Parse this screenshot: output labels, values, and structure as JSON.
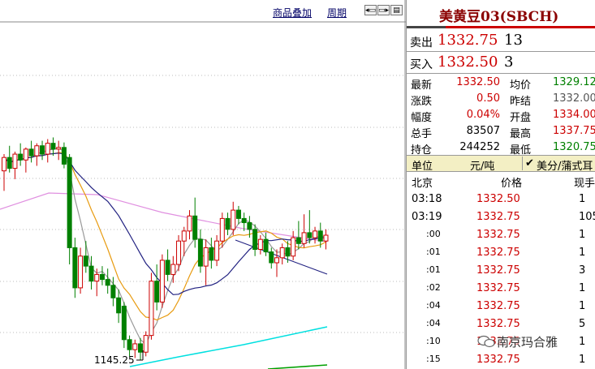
{
  "toolbar": {
    "overlay_label": "商品叠加",
    "period_label": "周期"
  },
  "chart": {
    "low_label": "1145.25"
  },
  "quote": {
    "title": "美黄豆03(SBCH)",
    "sell_label": "卖出",
    "sell_price": "1332.75",
    "sell_volume": "13",
    "buy_label": "买入",
    "buy_price": "1332.50",
    "buy_volume": "3",
    "rows": [
      {
        "l1": "最新",
        "v1": "1332.50",
        "c1": "#cc0000",
        "l2": "均价",
        "v2": "1329.12",
        "c2": "#008000"
      },
      {
        "l1": "涨跌",
        "v1": "0.50",
        "c1": "#cc0000",
        "l2": "昨结",
        "v2": "1332.00",
        "c2": "#555555"
      },
      {
        "l1": "幅度",
        "v1": "0.04%",
        "c1": "#cc0000",
        "l2": "开盘",
        "v2": "1334.00",
        "c2": "#cc0000"
      },
      {
        "l1": "总手",
        "v1": "83507",
        "c1": "#000000",
        "l2": "最高",
        "v2": "1337.75",
        "c2": "#cc0000"
      },
      {
        "l1": "持仓",
        "v1": "244252",
        "c1": "#000000",
        "l2": "最低",
        "v2": "1320.75",
        "c2": "#008000"
      }
    ]
  },
  "units": {
    "label": "单位",
    "value": "元/吨",
    "unit2": "美分/蒲式耳"
  },
  "ticks": {
    "head_time": "北京",
    "head_price": "价格",
    "head_vol": "现手",
    "rows": [
      {
        "time": "03:18",
        "sub": false,
        "price": "1332.50",
        "vol": "1"
      },
      {
        "time": "03:19",
        "sub": false,
        "price": "1332.75",
        "vol": "105"
      },
      {
        "time": ":00",
        "sub": true,
        "price": "1332.75",
        "vol": "1"
      },
      {
        "time": ":01",
        "sub": true,
        "price": "1332.75",
        "vol": "1"
      },
      {
        "time": ":01",
        "sub": true,
        "price": "1332.75",
        "vol": "3"
      },
      {
        "time": ":02",
        "sub": true,
        "price": "1332.75",
        "vol": "1"
      },
      {
        "time": ":04",
        "sub": true,
        "price": "1332.75",
        "vol": "1"
      },
      {
        "time": ":04",
        "sub": true,
        "price": "1332.75",
        "vol": "5"
      },
      {
        "time": ":10",
        "sub": true,
        "price": "1332.75",
        "vol": "1"
      },
      {
        "time": ":15",
        "sub": true,
        "price": "1332.75",
        "vol": "1"
      }
    ]
  },
  "watermark": {
    "text": "南京玛合雅"
  },
  "colors": {
    "up": "#cc0000",
    "down": "#008000",
    "ma_orange": "#e89b10",
    "ma_navy": "#202080",
    "ma_pink": "#e090e0",
    "ma_cyan": "#00e0e0"
  },
  "candles": [
    {
      "o": 1242,
      "h": 1262,
      "l": 1218,
      "c": 1258
    },
    {
      "o": 1258,
      "h": 1272,
      "l": 1240,
      "c": 1245
    },
    {
      "o": 1245,
      "h": 1265,
      "l": 1232,
      "c": 1262
    },
    {
      "o": 1262,
      "h": 1275,
      "l": 1248,
      "c": 1255
    },
    {
      "o": 1255,
      "h": 1270,
      "l": 1240,
      "c": 1268
    },
    {
      "o": 1268,
      "h": 1278,
      "l": 1252,
      "c": 1260
    },
    {
      "o": 1260,
      "h": 1275,
      "l": 1248,
      "c": 1272
    },
    {
      "o": 1272,
      "h": 1278,
      "l": 1255,
      "c": 1262
    },
    {
      "o": 1262,
      "h": 1280,
      "l": 1252,
      "c": 1275
    },
    {
      "o": 1275,
      "h": 1282,
      "l": 1260,
      "c": 1268
    },
    {
      "o": 1268,
      "h": 1278,
      "l": 1255,
      "c": 1270
    },
    {
      "o": 1270,
      "h": 1276,
      "l": 1245,
      "c": 1250
    },
    {
      "o": 1258,
      "h": 1262,
      "l": 1130,
      "c": 1150
    },
    {
      "o": 1150,
      "h": 1162,
      "l": 1090,
      "c": 1102
    },
    {
      "o": 1102,
      "h": 1150,
      "l": 1095,
      "c": 1140
    },
    {
      "o": 1140,
      "h": 1158,
      "l": 1120,
      "c": 1128
    },
    {
      "o": 1128,
      "h": 1140,
      "l": 1100,
      "c": 1110
    },
    {
      "o": 1110,
      "h": 1125,
      "l": 1092,
      "c": 1118
    },
    {
      "o": 1118,
      "h": 1128,
      "l": 1105,
      "c": 1112
    },
    {
      "o": 1112,
      "h": 1125,
      "l": 1095,
      "c": 1105
    },
    {
      "o": 1105,
      "h": 1115,
      "l": 1080,
      "c": 1090
    },
    {
      "o": 1090,
      "h": 1100,
      "l": 1060,
      "c": 1072
    },
    {
      "o": 1080,
      "h": 1085,
      "l": 1030,
      "c": 1040
    },
    {
      "o": 1040,
      "h": 1045,
      "l": 1020,
      "c": 1028
    },
    {
      "o": 1028,
      "h": 1040,
      "l": 1018,
      "c": 1035
    },
    {
      "o": 1035,
      "h": 1042,
      "l": 1015,
      "c": 1025
    },
    {
      "o": 1025,
      "h": 1050,
      "l": 1020,
      "c": 1045
    },
    {
      "o": 1045,
      "h": 1120,
      "l": 1040,
      "c": 1110
    },
    {
      "o": 1110,
      "h": 1130,
      "l": 1075,
      "c": 1085
    },
    {
      "o": 1085,
      "h": 1142,
      "l": 1078,
      "c": 1135
    },
    {
      "o": 1135,
      "h": 1148,
      "l": 1110,
      "c": 1118
    },
    {
      "o": 1118,
      "h": 1140,
      "l": 1108,
      "c": 1130
    },
    {
      "o": 1130,
      "h": 1165,
      "l": 1122,
      "c": 1158
    },
    {
      "o": 1158,
      "h": 1175,
      "l": 1140,
      "c": 1170
    },
    {
      "o": 1170,
      "h": 1195,
      "l": 1160,
      "c": 1188
    },
    {
      "o": 1188,
      "h": 1210,
      "l": 1150,
      "c": 1160
    },
    {
      "o": 1160,
      "h": 1172,
      "l": 1120,
      "c": 1128
    },
    {
      "o": 1128,
      "h": 1160,
      "l": 1105,
      "c": 1150
    },
    {
      "o": 1150,
      "h": 1162,
      "l": 1125,
      "c": 1135
    },
    {
      "o": 1135,
      "h": 1165,
      "l": 1128,
      "c": 1158
    },
    {
      "o": 1158,
      "h": 1192,
      "l": 1150,
      "c": 1185
    },
    {
      "o": 1185,
      "h": 1192,
      "l": 1165,
      "c": 1172
    },
    {
      "o": 1172,
      "h": 1205,
      "l": 1165,
      "c": 1195
    },
    {
      "o": 1195,
      "h": 1200,
      "l": 1178,
      "c": 1185
    },
    {
      "o": 1185,
      "h": 1192,
      "l": 1170,
      "c": 1180
    },
    {
      "o": 1180,
      "h": 1188,
      "l": 1162,
      "c": 1172
    },
    {
      "o": 1172,
      "h": 1178,
      "l": 1140,
      "c": 1148
    },
    {
      "o": 1148,
      "h": 1165,
      "l": 1142,
      "c": 1160
    },
    {
      "o": 1160,
      "h": 1168,
      "l": 1140,
      "c": 1145
    },
    {
      "o": 1145,
      "h": 1150,
      "l": 1125,
      "c": 1132
    },
    {
      "o": 1132,
      "h": 1148,
      "l": 1115,
      "c": 1138
    },
    {
      "o": 1138,
      "h": 1155,
      "l": 1130,
      "c": 1150
    },
    {
      "o": 1150,
      "h": 1158,
      "l": 1132,
      "c": 1140
    },
    {
      "o": 1140,
      "h": 1170,
      "l": 1135,
      "c": 1162
    },
    {
      "o": 1162,
      "h": 1182,
      "l": 1148,
      "c": 1155
    },
    {
      "o": 1155,
      "h": 1190,
      "l": 1150,
      "c": 1168
    },
    {
      "o": 1168,
      "h": 1195,
      "l": 1155,
      "c": 1162
    },
    {
      "o": 1162,
      "h": 1175,
      "l": 1155,
      "c": 1170
    },
    {
      "o": 1170,
      "h": 1180,
      "l": 1150,
      "c": 1158
    },
    {
      "o": 1158,
      "h": 1172,
      "l": 1148,
      "c": 1165
    }
  ]
}
